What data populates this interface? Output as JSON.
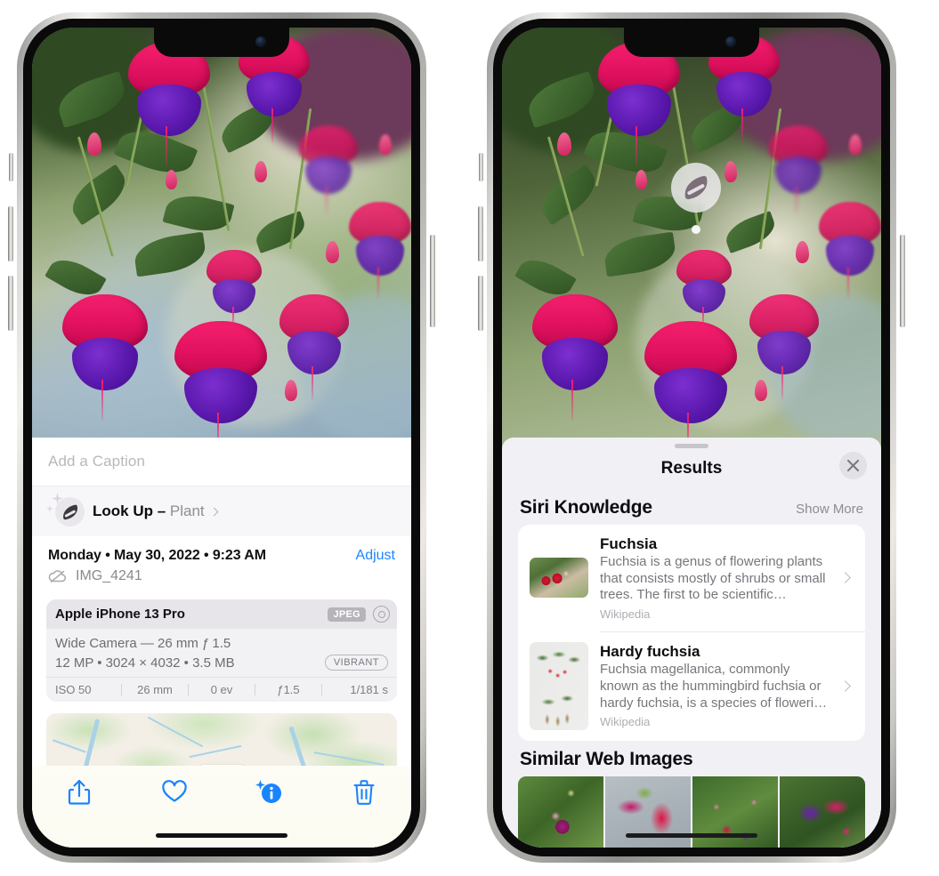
{
  "left_phone": {
    "photo": {
      "alt_name": "fuchsia-flowers-photo"
    },
    "caption_placeholder": "Add a Caption",
    "lookup": {
      "label": "Look Up – ",
      "subject": "Plant",
      "icon": "leaf-icon",
      "sparkle_icon": "sparkles-icon"
    },
    "date": "Monday • May 30, 2022 • 9:23 AM",
    "adjust_label": "Adjust",
    "filename": "IMG_4241",
    "cloud_icon": "cloud-slash-icon",
    "metadata": {
      "device": "Apple iPhone 13 Pro",
      "format_badge": "JPEG",
      "aperture_icon": "aperture-icon",
      "lens_line": "Wide Camera — 26 mm ƒ 1.5",
      "size_line": "12 MP • 3024 × 4032 • 3.5 MB",
      "style_badge": "VIBRANT",
      "exif": [
        "ISO 50",
        "26 mm",
        "0 ev",
        "ƒ1.5",
        "1/181 s"
      ]
    },
    "toolbar": [
      {
        "name": "share-button",
        "icon": "share-icon"
      },
      {
        "name": "favorite-button",
        "icon": "heart-icon"
      },
      {
        "name": "info-button",
        "icon": "info-sparkle-icon"
      },
      {
        "name": "delete-button",
        "icon": "trash-icon"
      }
    ],
    "accent_color": "#1a84ff"
  },
  "right_phone": {
    "visual_lookup_badge": {
      "icon": "leaf-icon"
    },
    "sheet": {
      "title": "Results",
      "close_icon": "close-icon",
      "siri_knowledge": {
        "heading": "Siri Knowledge",
        "action": "Show More",
        "cards": [
          {
            "title": "Fuchsia",
            "description": "Fuchsia is a genus of flowering plants that consists mostly of shrubs or small trees. The first to be scientific…",
            "source": "Wikipedia",
            "thumb": "fuchsia-red-flowers-thumbnail"
          },
          {
            "title": "Hardy fuchsia",
            "description": "Fuchsia magellanica, commonly known as the hummingbird fuchsia or hardy fuchsia, is a species of floweri…",
            "source": "Wikipedia",
            "thumb": "hardy-fuchsia-specimen-thumbnail"
          }
        ]
      },
      "similar_web_images": {
        "heading": "Similar Web Images",
        "thumbnails": [
          "fuchsia-pink-white-bloom",
          "fuchsia-red-closeup",
          "fuchsia-bush-buds",
          "fuchsia-purple-magenta-cluster"
        ]
      }
    }
  }
}
